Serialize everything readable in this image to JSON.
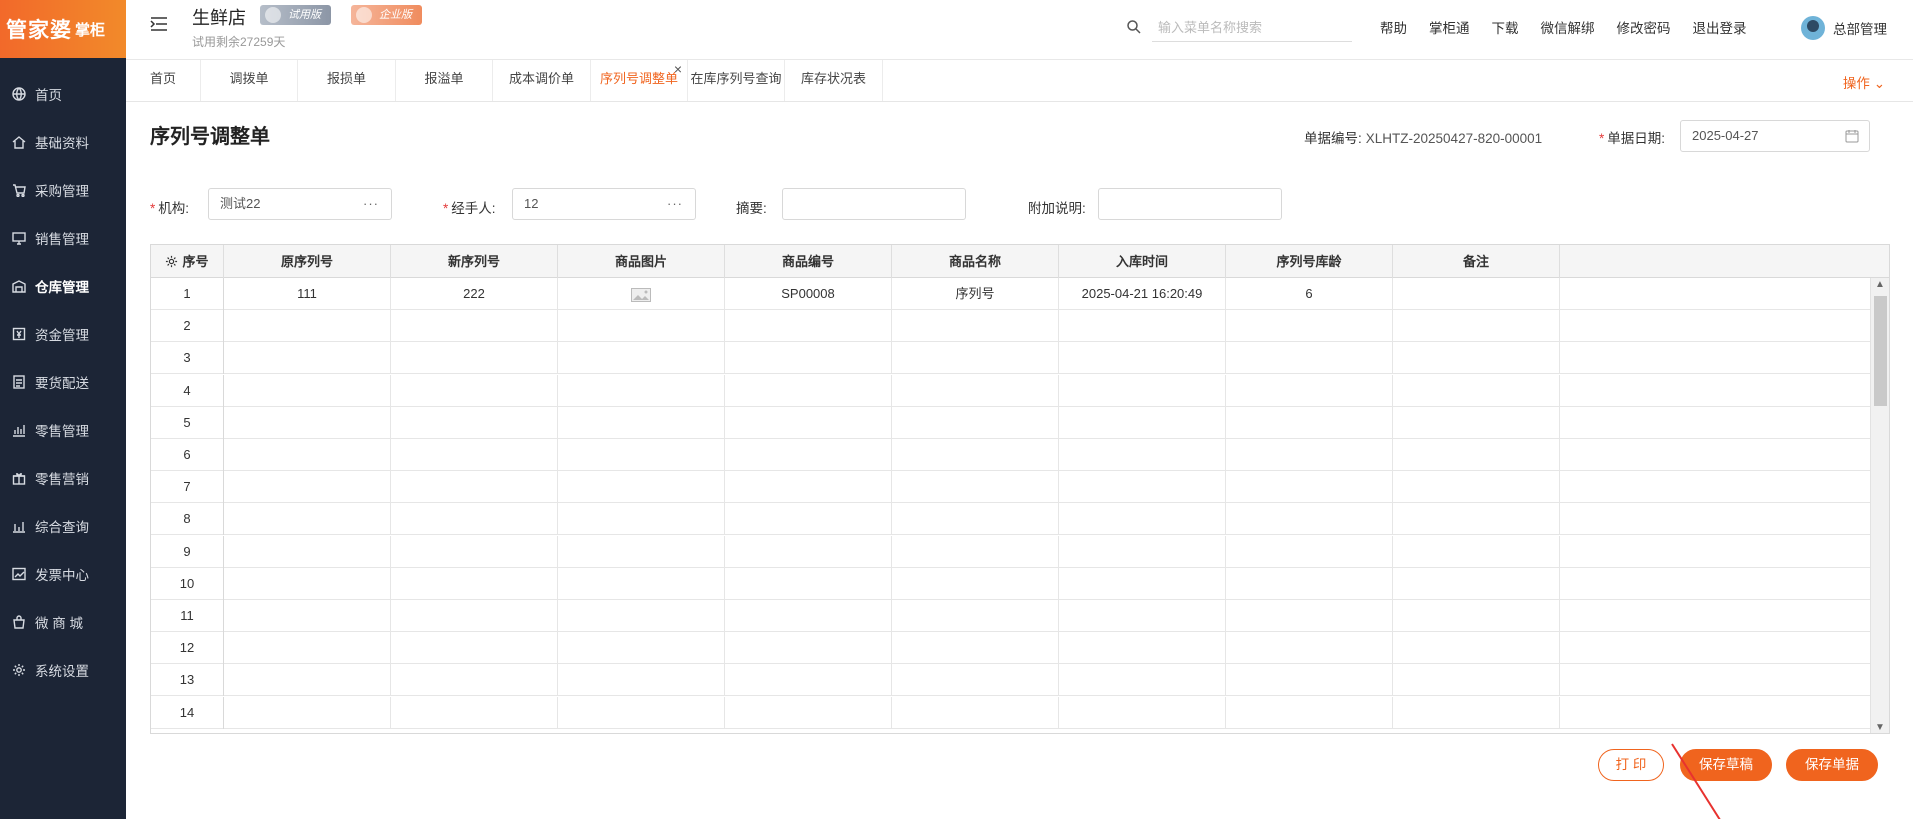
{
  "brand": {
    "logo_main": "管家婆",
    "logo_sub": "掌柜"
  },
  "sidebar": {
    "items": [
      {
        "label": "首页",
        "icon": "globe-icon"
      },
      {
        "label": "基础资料",
        "icon": "home-icon"
      },
      {
        "label": "采购管理",
        "icon": "cart-icon"
      },
      {
        "label": "销售管理",
        "icon": "monitor-icon"
      },
      {
        "label": "仓库管理",
        "icon": "warehouse-icon",
        "active": true
      },
      {
        "label": "资金管理",
        "icon": "money-icon"
      },
      {
        "label": "要货配送",
        "icon": "doc-icon"
      },
      {
        "label": "零售管理",
        "icon": "chart-icon"
      },
      {
        "label": "零售营销",
        "icon": "gift-icon"
      },
      {
        "label": "综合查询",
        "icon": "bar-icon"
      },
      {
        "label": "发票中心",
        "icon": "trend-icon"
      },
      {
        "label": "微 商 城",
        "icon": "bag-icon"
      },
      {
        "label": "系统设置",
        "icon": "gear-icon"
      }
    ]
  },
  "header": {
    "store_name": "生鲜店",
    "badge_trial": "试用版",
    "badge_enterprise": "企业版",
    "trial_note": "试用剩余27259天",
    "search_placeholder": "输入菜单名称搜索",
    "links": [
      "帮助",
      "掌柜通",
      "下载",
      "微信解绑",
      "修改密码",
      "退出登录"
    ],
    "user": "总部管理"
  },
  "tabs": {
    "items": [
      "首页",
      "调拨单",
      "报损单",
      "报溢单",
      "成本调价单",
      "序列号调整单",
      "在库序列号查询",
      "库存状况表"
    ],
    "active_index": 5,
    "ops_label": "操作"
  },
  "form": {
    "title": "序列号调整单",
    "doc_no_label": "单据编号:",
    "doc_no": "XLHTZ-20250427-820-00001",
    "date_label": "单据日期:",
    "date": "2025-04-27",
    "org_label": "机构:",
    "org_value": "测试22",
    "handler_label": "经手人:",
    "handler_value": "12",
    "summary_label": "摘要:",
    "summary_value": "",
    "note_label": "附加说明:",
    "note_value": ""
  },
  "grid": {
    "columns": [
      "序号",
      "原序列号",
      "新序列号",
      "商品图片",
      "商品编号",
      "商品名称",
      "入库时间",
      "序列号库龄",
      "备注"
    ],
    "rows": [
      {
        "idx": "1",
        "orig_sn": "111",
        "new_sn": "222",
        "image": true,
        "code": "SP00008",
        "name": "序列号",
        "in_time": "2025-04-21 16:20:49",
        "age": "6",
        "remark": ""
      },
      {
        "idx": "2"
      },
      {
        "idx": "3"
      },
      {
        "idx": "4"
      },
      {
        "idx": "5"
      },
      {
        "idx": "6"
      },
      {
        "idx": "7"
      },
      {
        "idx": "8"
      },
      {
        "idx": "9"
      },
      {
        "idx": "10"
      },
      {
        "idx": "11"
      },
      {
        "idx": "12"
      },
      {
        "idx": "13"
      },
      {
        "idx": "14"
      }
    ]
  },
  "buttons": {
    "print": "打 印",
    "save_draft": "保存草稿",
    "save_doc": "保存单据"
  },
  "colors": {
    "accent": "#f0641e",
    "sidebar_bg": "#1c2536"
  }
}
